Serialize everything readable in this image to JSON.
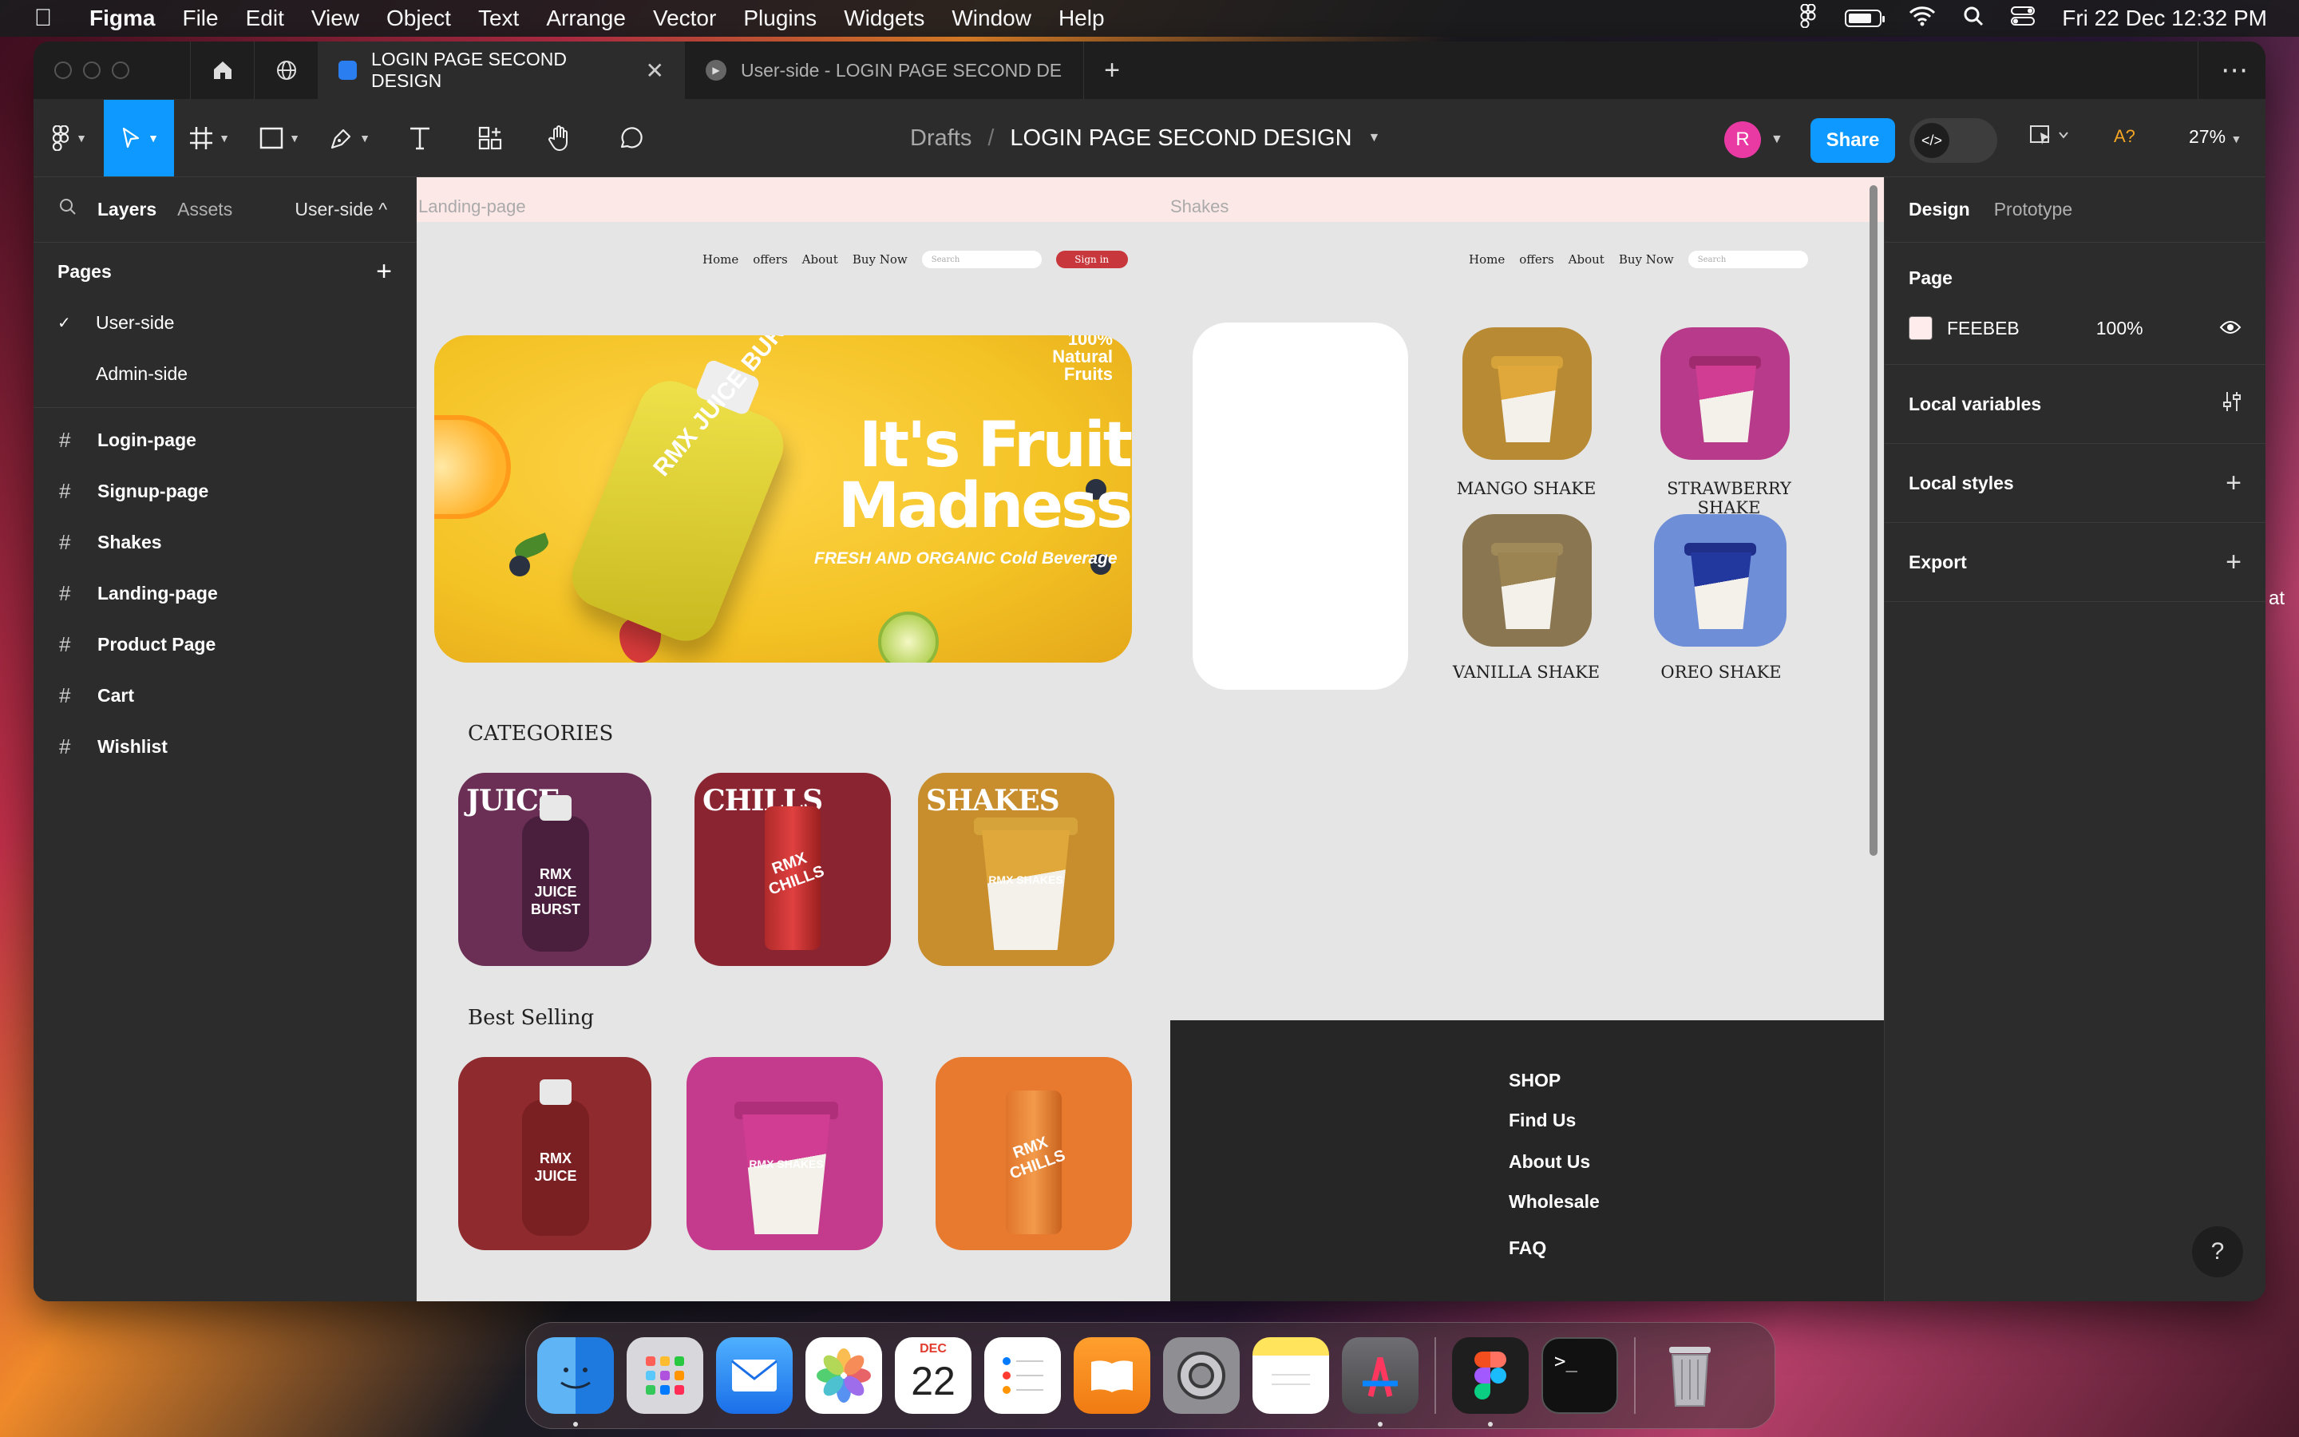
{
  "menubar": {
    "apple": "",
    "app": "Figma",
    "items": [
      "File",
      "Edit",
      "View",
      "Object",
      "Text",
      "Arrange",
      "Vector",
      "Plugins",
      "Widgets",
      "Window",
      "Help"
    ],
    "datetime": "Fri 22 Dec  12:32 PM"
  },
  "tabs": {
    "active": "LOGIN PAGE SECOND DESIGN",
    "inactive": "User-side - LOGIN PAGE SECOND DE",
    "close_glyph": "✕",
    "plus_glyph": "+",
    "more_glyph": "⋯"
  },
  "toolbar": {
    "breadcrumb_root": "Drafts",
    "breadcrumb_sep": "/",
    "file_name": "LOGIN PAGE SECOND DESIGN",
    "avatar_initial": "R",
    "share_label": "Share",
    "dev_glyph": "</>",
    "missing_fonts": "A?",
    "zoom": "27%"
  },
  "left_panel": {
    "tabs": [
      "Layers",
      "Assets"
    ],
    "page_selector": "User-side ^",
    "pages_title": "Pages",
    "pages": [
      {
        "name": "User-side",
        "selected": true
      },
      {
        "name": "Admin-side",
        "selected": false
      }
    ],
    "frames": [
      "Login-page",
      "Signup-page",
      "Shakes",
      "Landing-page",
      "Product Page",
      "Cart",
      "Wishlist"
    ]
  },
  "right_panel": {
    "tabs": [
      "Design",
      "Prototype"
    ],
    "page_section": "Page",
    "page_color_hex": "FEEBEB",
    "page_color": "#FEEBEB",
    "page_opacity": "100%",
    "sections": [
      "Local variables",
      "Local styles",
      "Export"
    ],
    "help": "?"
  },
  "canvas": {
    "landing": {
      "label": "Landing-page",
      "nav": [
        "Home",
        "offers",
        "About",
        "Buy Now"
      ],
      "search_placeholder": "Search",
      "signin": "Sign in",
      "hero": {
        "natural": "100%\nNatural\nFruits",
        "headline": "It's Fruit Madness",
        "tagline": "FRESH AND ORGANIC Cold Beverage",
        "bottle_label": "RMX JUICE BURST"
      },
      "categories_title": "CATEGORIES",
      "categories": [
        {
          "title": "JUICE",
          "color": "#6b2e55",
          "label": "RMX JUICE BURST"
        },
        {
          "title": "CHILLS",
          "color": "#8a2430",
          "label": "RMX CHILLS"
        },
        {
          "title": "SHAKES",
          "color": "#c88e2e",
          "label": "RMX SHAKES"
        }
      ],
      "best_title": "Best Selling",
      "best": [
        {
          "color": "#8f2a2e",
          "label": "RMX JUICE"
        },
        {
          "color": "#c43a8c",
          "label": "RMX SHAKES"
        },
        {
          "color": "#e87a30",
          "label": "RMX CHILLS"
        }
      ]
    },
    "shakes": {
      "label": "Shakes",
      "nav": [
        "Home",
        "offers",
        "About",
        "Buy Now"
      ],
      "search_placeholder": "Search",
      "items": [
        {
          "name": "MANGO SHAKE",
          "color": "#b88a34"
        },
        {
          "name": "STRAWBERRY SHAKE",
          "color": "#b83a8a"
        },
        {
          "name": "VANILLA SHAKE",
          "color": "#8a7650"
        },
        {
          "name": "OREO SHAKE",
          "color": "#6f8ed8"
        }
      ],
      "footer_links": [
        "SHOP",
        "Find Us",
        "About Us",
        "Wholesale",
        "FAQ"
      ]
    }
  },
  "dock": {
    "calendar_month": "DEC",
    "calendar_day": "22"
  },
  "edge_text": "at"
}
